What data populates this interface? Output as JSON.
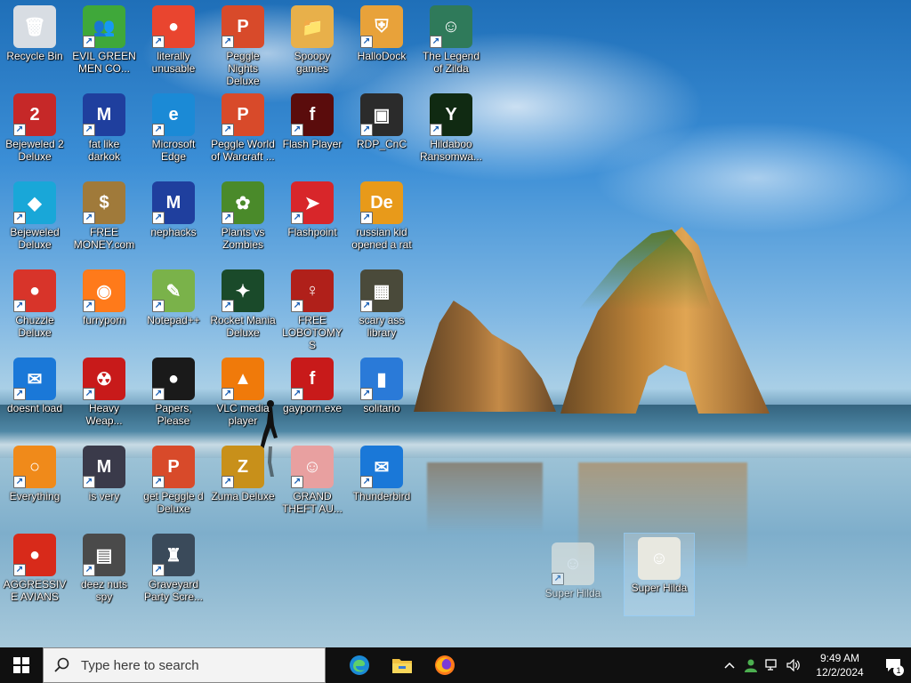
{
  "desktop": {
    "icons": [
      {
        "label": "Recycle Bin",
        "glyph": "🗑",
        "color": "#d8dde3",
        "shortcut": false,
        "selected": false
      },
      {
        "label": "EVIL GREEN MEN CO...",
        "glyph": "👥",
        "color": "#3fa83a",
        "shortcut": true,
        "selected": false
      },
      {
        "label": "literally unusable",
        "glyph": "●",
        "color": "#e9452f",
        "shortcut": true,
        "selected": false
      },
      {
        "label": "Peggle Nights Deluxe",
        "glyph": "P",
        "color": "#d84a2a",
        "shortcut": true,
        "selected": false
      },
      {
        "label": "Spoopy games",
        "glyph": "📁",
        "color": "#e8b04a",
        "shortcut": false,
        "selected": false
      },
      {
        "label": "HalloDock",
        "glyph": "⛨",
        "color": "#e8a23a",
        "shortcut": true,
        "selected": false
      },
      {
        "label": "The Legend of Zilda",
        "glyph": "☺",
        "color": "#2f7a5a",
        "shortcut": true,
        "selected": false
      },
      {
        "label": "Bejeweled 2 Deluxe",
        "glyph": "2",
        "color": "#c62828",
        "shortcut": true,
        "selected": false
      },
      {
        "label": "fat like darkok",
        "glyph": "M",
        "color": "#1f3f9e",
        "shortcut": true,
        "selected": false
      },
      {
        "label": "Microsoft Edge",
        "glyph": "e",
        "color": "#1b8ad6",
        "shortcut": true,
        "selected": false
      },
      {
        "label": "Peggle World of Warcraft ...",
        "glyph": "P",
        "color": "#d84a2a",
        "shortcut": true,
        "selected": false
      },
      {
        "label": "Flash Player",
        "glyph": "f",
        "color": "#5a0c0c",
        "shortcut": true,
        "selected": false
      },
      {
        "label": "RDP_CnC",
        "glyph": "▣",
        "color": "#2b2b2b",
        "shortcut": true,
        "selected": false
      },
      {
        "label": "Hildaboo Ransomwa...",
        "glyph": "Y",
        "color": "#102a12",
        "shortcut": true,
        "selected": false
      },
      {
        "label": "Bejeweled Deluxe",
        "glyph": "◆",
        "color": "#19a7d8",
        "shortcut": true,
        "selected": false
      },
      {
        "label": "FREE MONEY.com",
        "glyph": "$",
        "color": "#a07a3a",
        "shortcut": true,
        "selected": false
      },
      {
        "label": "nephacks",
        "glyph": "M",
        "color": "#1f3f9e",
        "shortcut": true,
        "selected": false
      },
      {
        "label": "Plants vs Zombies",
        "glyph": "✿",
        "color": "#4a8a2a",
        "shortcut": true,
        "selected": false
      },
      {
        "label": "Flashpoint",
        "glyph": "➤",
        "color": "#d8262a",
        "shortcut": true,
        "selected": false
      },
      {
        "label": "russian kid opened a rat",
        "glyph": "De",
        "color": "#e89a1a",
        "shortcut": true,
        "selected": false
      },
      {
        "label": "Chuzzle Deluxe",
        "glyph": "●",
        "color": "#d8342a",
        "shortcut": true,
        "selected": false
      },
      {
        "label": "furryporn",
        "glyph": "◉",
        "color": "#ff7a1a",
        "shortcut": true,
        "selected": false
      },
      {
        "label": "Notepad++",
        "glyph": "✎",
        "color": "#7ab24a",
        "shortcut": true,
        "selected": false
      },
      {
        "label": "Rocket Mania Deluxe",
        "glyph": "✦",
        "color": "#1a4a2a",
        "shortcut": true,
        "selected": false
      },
      {
        "label": "FREE LOBOTOMYS",
        "glyph": "♀",
        "color": "#b0201a",
        "shortcut": true,
        "selected": false
      },
      {
        "label": "scary ass library",
        "glyph": "▦",
        "color": "#4a4a3a",
        "shortcut": true,
        "selected": false
      },
      {
        "label": "doesnt load",
        "glyph": "✉",
        "color": "#1a78d8",
        "shortcut": true,
        "selected": false
      },
      {
        "label": "Heavy Weap...",
        "glyph": "☢",
        "color": "#c81a1a",
        "shortcut": true,
        "selected": false
      },
      {
        "label": "Papers, Please",
        "glyph": "●",
        "color": "#1a1a1a",
        "shortcut": true,
        "selected": false
      },
      {
        "label": "VLC media player",
        "glyph": "▲",
        "color": "#f07a0a",
        "shortcut": true,
        "selected": false
      },
      {
        "label": "gayporn.exe",
        "glyph": "f",
        "color": "#c81a1a",
        "shortcut": true,
        "selected": false
      },
      {
        "label": "solitario",
        "glyph": "▮",
        "color": "#2a7ad8",
        "shortcut": true,
        "selected": false
      },
      {
        "label": "Everything",
        "glyph": "○",
        "color": "#f08a1a",
        "shortcut": true,
        "selected": false
      },
      {
        "label": "is very",
        "glyph": "M",
        "color": "#3a3a4a",
        "shortcut": true,
        "selected": false
      },
      {
        "label": "get Peggle d Deluxe",
        "glyph": "P",
        "color": "#d84a2a",
        "shortcut": true,
        "selected": false
      },
      {
        "label": "Zuma Deluxe",
        "glyph": "Z",
        "color": "#c8901a",
        "shortcut": true,
        "selected": false
      },
      {
        "label": "GRAND THEFT AU...",
        "glyph": "☺",
        "color": "#e8a0a0",
        "shortcut": true,
        "selected": false
      },
      {
        "label": "Thunderbird",
        "glyph": "✉",
        "color": "#1a78d8",
        "shortcut": true,
        "selected": false
      },
      {
        "label": "AGGRESSIVE AVIANS",
        "glyph": "●",
        "color": "#d82a1a",
        "shortcut": true,
        "selected": false
      },
      {
        "label": "deez nuts spy",
        "glyph": "▤",
        "color": "#4a4a4a",
        "shortcut": true,
        "selected": false
      },
      {
        "label": "Graveyard Party Scre...",
        "glyph": "♜",
        "color": "#3a4a5a",
        "shortcut": true,
        "selected": false
      },
      {
        "label": "Super Hilda",
        "glyph": "☺",
        "color": "#e8e8e0",
        "shortcut": true,
        "selected": false,
        "ghost": true
      },
      {
        "label": "Super Hilda",
        "glyph": "☺",
        "color": "#e8e8e0",
        "shortcut": false,
        "selected": true
      }
    ]
  },
  "taskbar": {
    "search_placeholder": "Type here to search",
    "apps": [
      {
        "name": "edge",
        "color": "#1b8ad6"
      },
      {
        "name": "file-explorer",
        "color": "#f0c040"
      },
      {
        "name": "firefox",
        "color": "#ff7a1a"
      }
    ],
    "clock_time": "9:49 AM",
    "clock_date": "12/2/2024",
    "notification_count": "1"
  }
}
